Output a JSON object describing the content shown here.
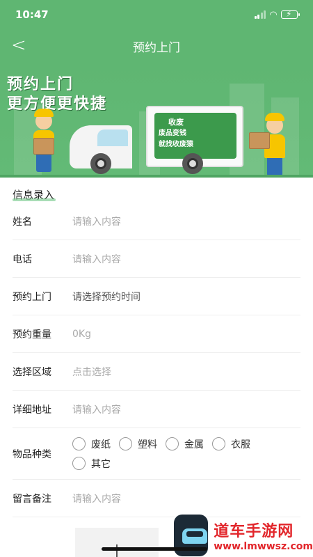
{
  "status_bar": {
    "time": "10:47"
  },
  "nav": {
    "back_icon": "chevron-left-icon",
    "title": "预约上门"
  },
  "banner": {
    "line1": "预约上门",
    "line2": "更方便更快捷",
    "sign_logo": "收废",
    "sign_line1": "废品变钱",
    "sign_line2": "就找收废猿"
  },
  "form": {
    "section_title": "信息录入",
    "fields": [
      {
        "label": "姓名",
        "value": "请输入内容"
      },
      {
        "label": "电话",
        "value": "请输入内容"
      },
      {
        "label": "预约上门",
        "value": "请选择预约时间"
      },
      {
        "label": "预约重量",
        "value": "0Kg"
      },
      {
        "label": "选择区域",
        "value": "点击选择"
      },
      {
        "label": "详细地址",
        "value": "请输入内容"
      }
    ],
    "category": {
      "label": "物品种类",
      "options": [
        "废纸",
        "塑料",
        "金属",
        "衣服",
        "其它"
      ]
    },
    "remark": {
      "label": "留言备注",
      "value": "请输入内容"
    }
  },
  "watermark": {
    "name": "道车手游网",
    "url": "www.lmwwsz.com"
  },
  "colors": {
    "primary": "#5fb672",
    "accent": "#f7c500"
  }
}
